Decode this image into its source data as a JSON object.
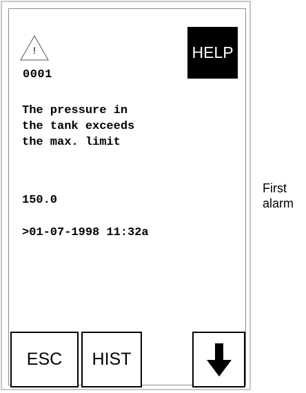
{
  "panel": {
    "alarm_number": "0001",
    "help_label": "HELP",
    "message": "The pressure in\nthe tank exceeds\nthe max. limit",
    "value": "150.0",
    "timestamp": ">01-07-1998 11:32a",
    "buttons": {
      "esc_label": "ESC",
      "hist_label": "HIST",
      "down_icon": "down-arrow-icon"
    }
  },
  "annotation": {
    "text": "First\nalarm"
  },
  "icons": {
    "warning": "warning-triangle-icon"
  },
  "colors": {
    "help_background": "#000000",
    "help_text": "#ffffff",
    "frame": "#c7c7c7"
  }
}
